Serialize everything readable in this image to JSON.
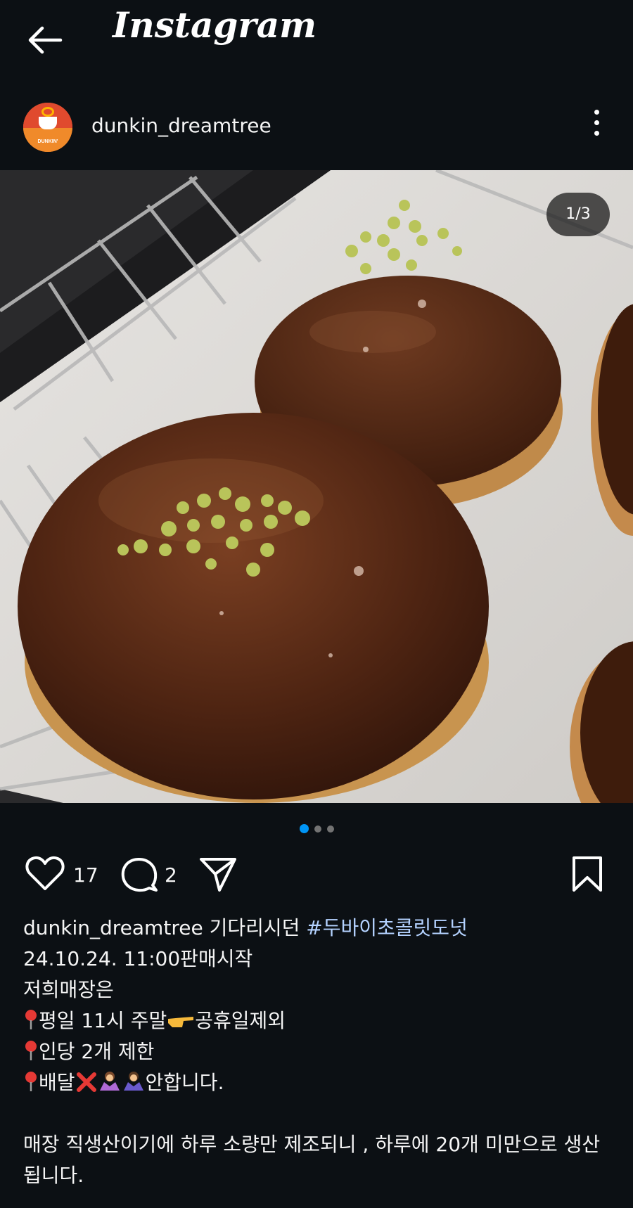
{
  "header": {
    "app_title": "Instagram"
  },
  "post": {
    "username": "dunkin_dreamtree",
    "avatar_label": "DUNKIN'",
    "image_counter": "1/3",
    "likes": "17",
    "comments": "2",
    "caption": {
      "username": "dunkin_dreamtree",
      "line1_text": " 기다리시던 ",
      "hashtag": "#두바이초콜릿도넛",
      "line2": "24.10.24. 11:00판매시작",
      "line3": "저희매장은",
      "line4a": "평일 11시 주말",
      "line4b": "공휴일제외",
      "line5": "인당 2개 제한",
      "line6a": "배달",
      "line6b": "안합니다.",
      "paragraph": "매장 직생산이기에 하루 소량만 제조되니 , 하루에 20개 미만으로 생산됩니다."
    }
  },
  "colors": {
    "background": "#0c1014",
    "accent": "#0095f6",
    "hashtag": "#b4d2ff"
  },
  "icons": [
    "back-arrow-icon",
    "more-options-icon",
    "heart-icon",
    "comment-icon",
    "share-icon",
    "bookmark-icon",
    "pin-icon",
    "pointing-hand-icon",
    "cross-mark-icon",
    "person-gesturing-no-icon"
  ]
}
